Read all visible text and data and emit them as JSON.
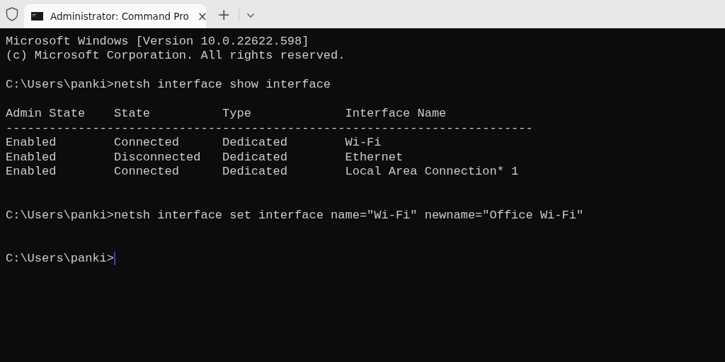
{
  "tabs": [
    {
      "title": "Administrator: Command Pro",
      "selected": true,
      "close": "×"
    }
  ],
  "new_tab": "+",
  "terminal": {
    "lines": [
      {
        "kind": "output",
        "text": "Microsoft Windows [Version 10.0.22622.598]"
      },
      {
        "kind": "output",
        "text": "(c) Microsoft Corporation. All rights reserved."
      },
      {
        "kind": "blank"
      },
      {
        "kind": "output",
        "text": "C:\\Users\\panki>netsh interface show interface"
      },
      {
        "kind": "blank"
      },
      {
        "kind": "output",
        "text": "Admin State    State          Type             Interface Name"
      },
      {
        "kind": "output",
        "text": "-------------------------------------------------------------------------"
      },
      {
        "kind": "output",
        "text": "Enabled        Connected      Dedicated        Wi-Fi"
      },
      {
        "kind": "output",
        "text": "Enabled        Disconnected   Dedicated        Ethernet"
      },
      {
        "kind": "output",
        "text": "Enabled        Connected      Dedicated        Local Area Connection* 1"
      },
      {
        "kind": "blank"
      },
      {
        "kind": "blank"
      },
      {
        "kind": "output",
        "text": "C:\\Users\\panki>netsh interface set interface name=\"Wi-Fi\" newname=\"Office Wi-Fi\""
      },
      {
        "kind": "blank"
      },
      {
        "kind": "blank"
      },
      {
        "kind": "prompt",
        "text": "C:\\Users\\panki>"
      }
    ]
  }
}
